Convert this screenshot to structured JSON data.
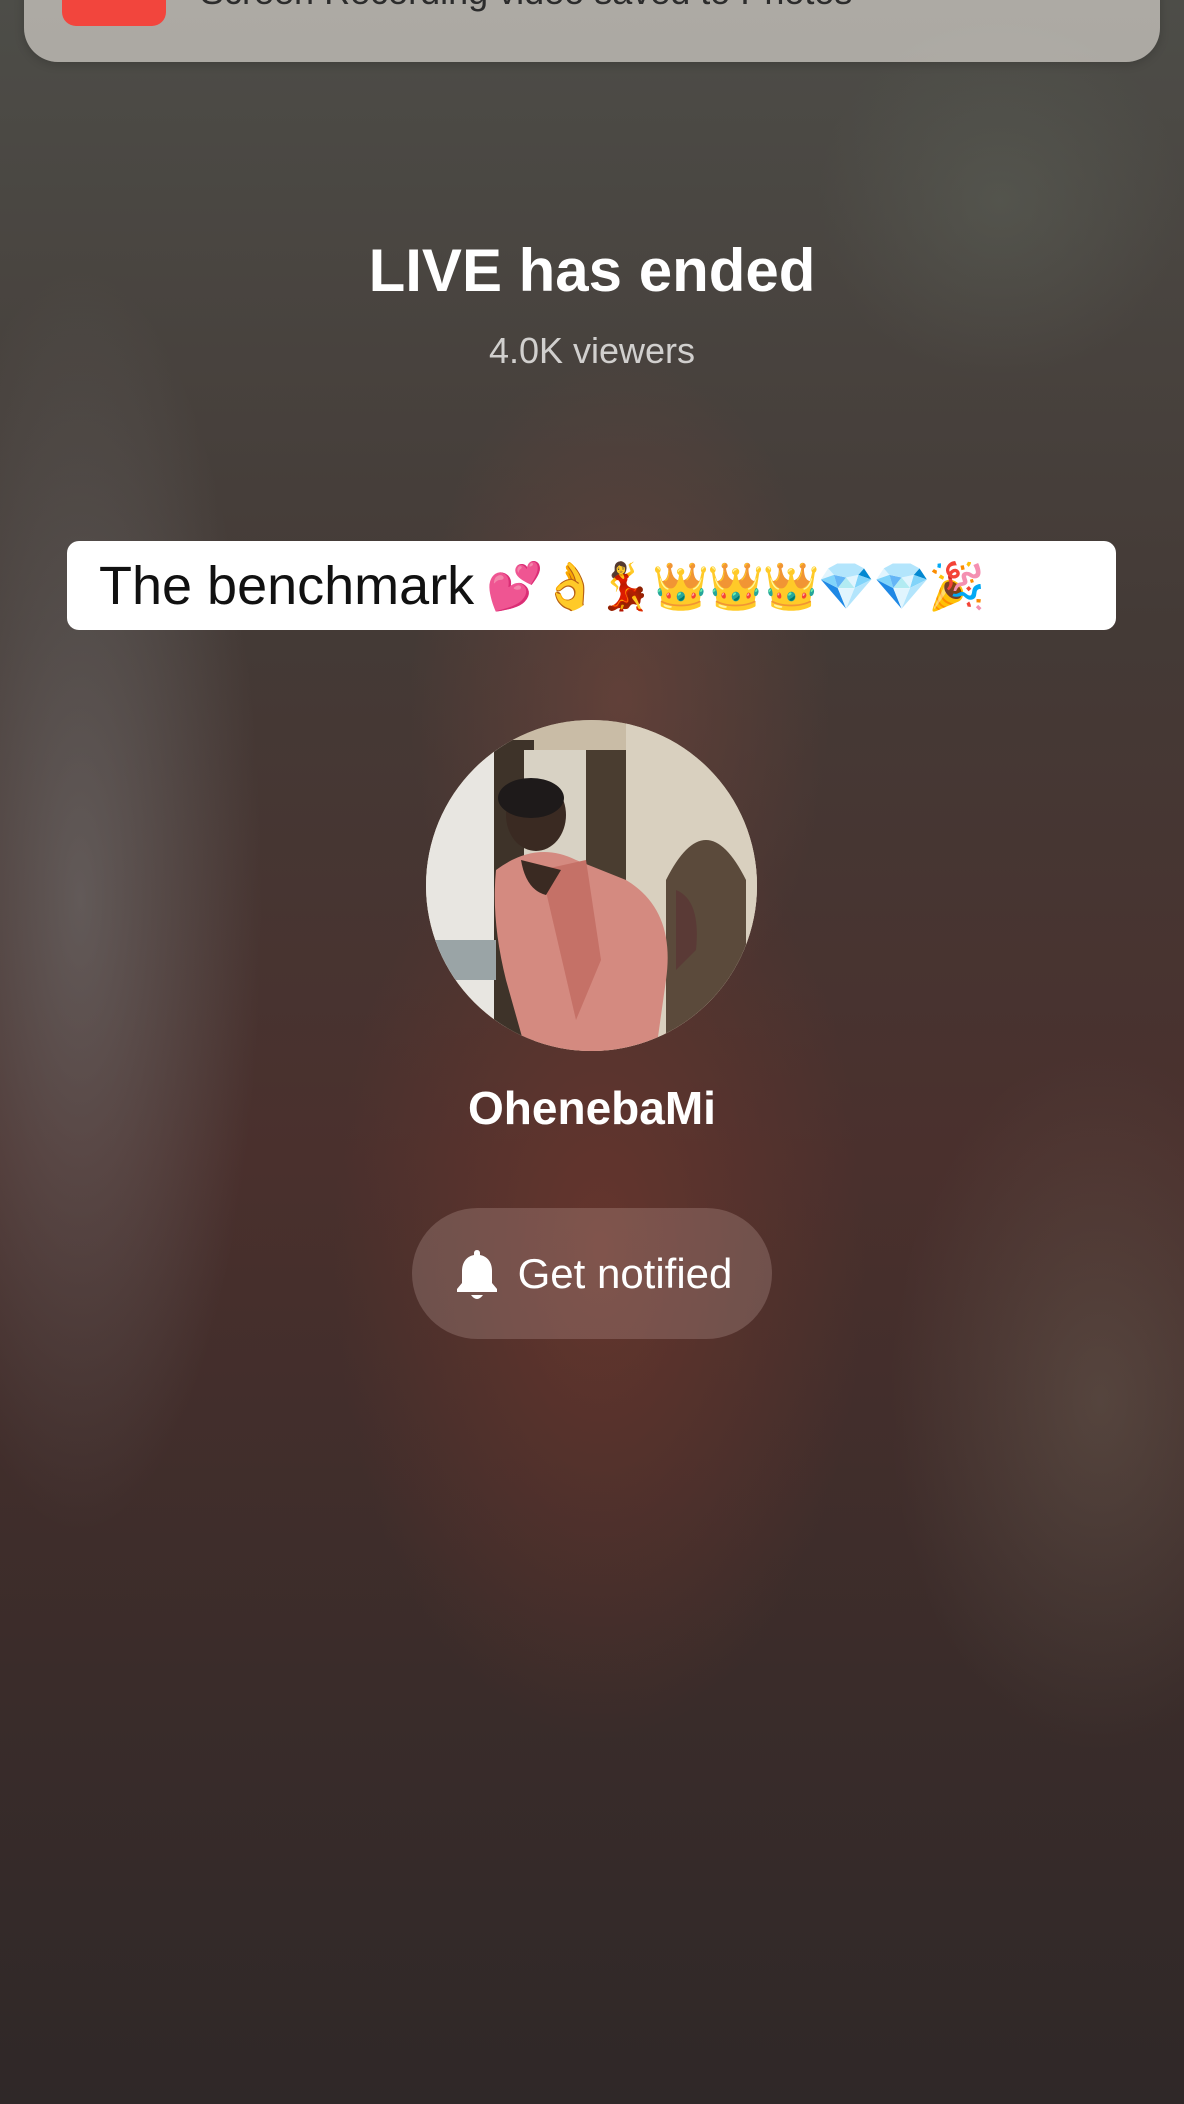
{
  "notification": {
    "icon": "screen-recording-icon",
    "text": "Screen Recording video saved to Photos"
  },
  "live": {
    "title": "LIVE has ended",
    "viewers": "4.0K viewers"
  },
  "caption": {
    "text": "The benchmark",
    "emojis": "💕👌💃👑👑👑💎💎🎉"
  },
  "profile": {
    "username": "OhenebaMi"
  },
  "notify_button": {
    "icon": "bell-icon",
    "label": "Get notified"
  },
  "colors": {
    "notification_icon": "#f2453d",
    "caption_background": "#ffffff"
  }
}
